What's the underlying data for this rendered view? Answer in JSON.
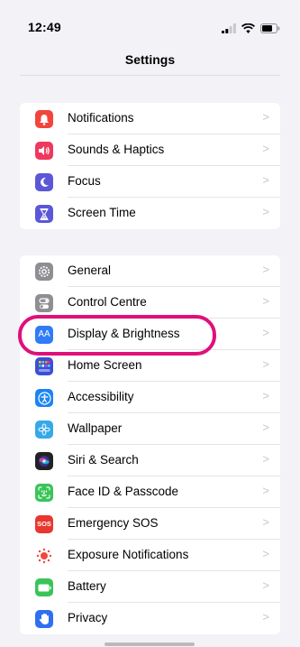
{
  "status_bar": {
    "time": "12:49"
  },
  "nav": {
    "title": "Settings"
  },
  "chevron": ">",
  "group1": [
    {
      "label": "Notifications",
      "icon": "bell-icon",
      "color": "#f2453d"
    },
    {
      "label": "Sounds & Haptics",
      "icon": "speaker-icon",
      "color": "#f0385e"
    },
    {
      "label": "Focus",
      "icon": "moon-icon",
      "color": "#5b57d6"
    },
    {
      "label": "Screen Time",
      "icon": "hourglass-icon",
      "color": "#5b57d6"
    }
  ],
  "group2": [
    {
      "label": "General",
      "icon": "gear-icon",
      "color": "#8e8e93"
    },
    {
      "label": "Control Centre",
      "icon": "toggles-icon",
      "color": "#8e8e93"
    },
    {
      "label": "Display & Brightness",
      "icon": "text-size-icon",
      "color": "#2f7cf6",
      "glyph": "AA"
    },
    {
      "label": "Home Screen",
      "icon": "app-grid-icon",
      "color": "#3a4fd8"
    },
    {
      "label": "Accessibility",
      "icon": "accessibility-icon",
      "color": "#1a84f5"
    },
    {
      "label": "Wallpaper",
      "icon": "flower-icon",
      "color": "#36a9e8"
    },
    {
      "label": "Siri & Search",
      "icon": "siri-icon",
      "color": "#222222"
    },
    {
      "label": "Face ID & Passcode",
      "icon": "face-id-icon",
      "color": "#3ac458"
    },
    {
      "label": "Emergency SOS",
      "icon": "sos-icon",
      "color": "#e8372f",
      "glyph": "SOS"
    },
    {
      "label": "Exposure Notifications",
      "icon": "exposure-icon",
      "color": "#ffffff"
    },
    {
      "label": "Battery",
      "icon": "battery-icon",
      "color": "#3ac458"
    },
    {
      "label": "Privacy",
      "icon": "hand-icon",
      "color": "#2f6ff0"
    }
  ],
  "highlight_color": "#e0107a"
}
